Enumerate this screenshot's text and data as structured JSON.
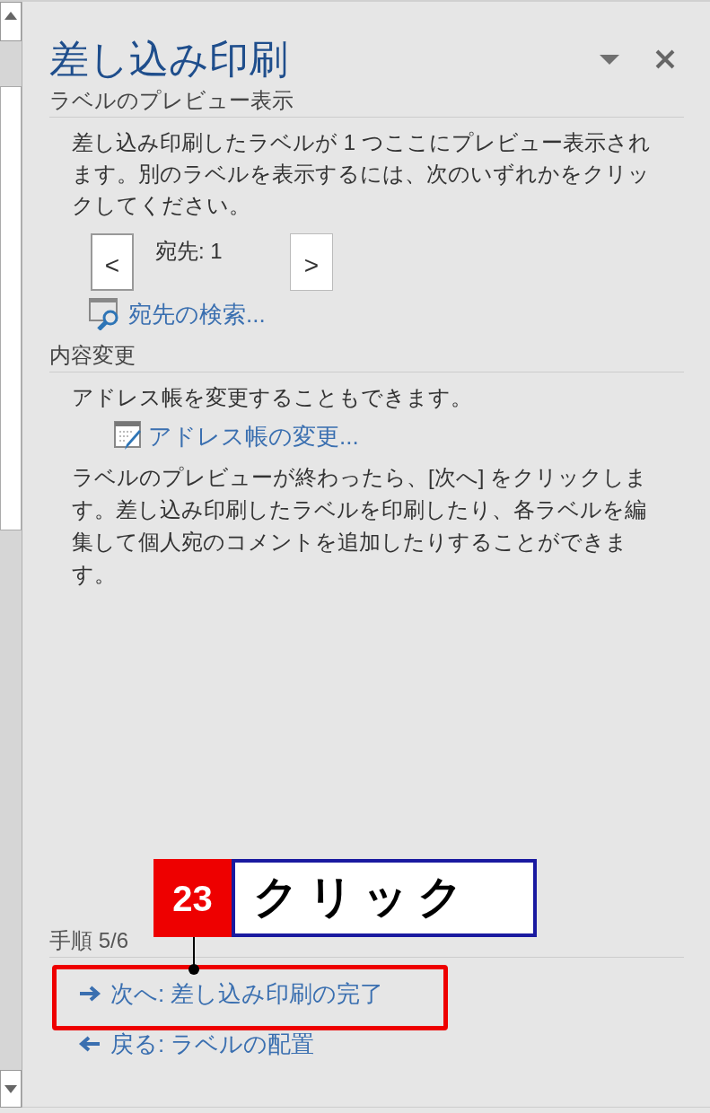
{
  "pane": {
    "title": "差し込み印刷",
    "sections": [
      {
        "heading": "ラベルのプレビュー表示",
        "description": "差し込み印刷したラベルが 1 つここにプレビュー表示されます。別のラベルを表示するには、次のいずれかをクリックしてください。",
        "navigator": {
          "previous": "<",
          "label": "宛先: 1",
          "next": ">"
        },
        "link": {
          "kind": "search",
          "label": "宛先の検索..."
        }
      },
      {
        "heading": "内容変更",
        "description": "アドレス帳を変更することもできます。",
        "link": {
          "kind": "edit",
          "label": "アドレス帳の変更..."
        },
        "note": "ラベルのプレビューが終わったら、[次へ] をクリックします。差し込み印刷したラベルを印刷したり、各ラベルを編集して個人宛のコメントを追加したりすることができます。"
      }
    ],
    "step": "手順 5/6",
    "next": "次へ: 差し込み印刷の完了",
    "back": "戻る: ラベルの配置"
  },
  "callout": {
    "number": "23",
    "text": "クリック"
  }
}
